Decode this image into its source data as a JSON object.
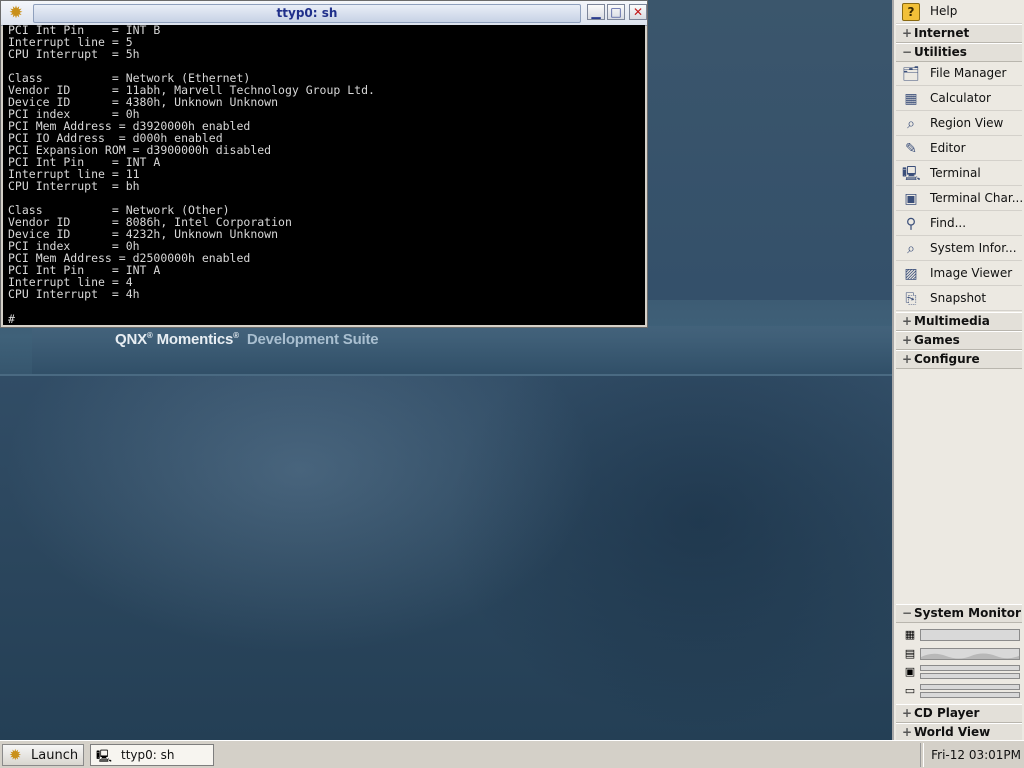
{
  "desktop": {
    "brand": "QNX",
    "brand_reg": "®",
    "brand_product": "Momentics",
    "brand_suffix": "Development Suite"
  },
  "terminal": {
    "title": "ttyp0: sh",
    "lines": [
      "PCI Int Pin    = INT B",
      "Interrupt line = 5",
      "CPU Interrupt  = 5h",
      "",
      "Class          = Network (Ethernet)",
      "Vendor ID      = 11abh, Marvell Technology Group Ltd.",
      "Device ID      = 4380h, Unknown Unknown",
      "PCI index      = 0h",
      "PCI Mem Address = d3920000h enabled",
      "PCI IO Address  = d000h enabled",
      "PCI Expansion ROM = d3900000h disabled",
      "PCI Int Pin    = INT A",
      "Interrupt line = 11",
      "CPU Interrupt  = bh",
      "",
      "Class          = Network (Other)",
      "Vendor ID      = 8086h, Intel Corporation",
      "Device ID      = 4232h, Unknown Unknown",
      "PCI index      = 0h",
      "PCI Mem Address = d2500000h enabled",
      "PCI Int Pin    = INT A",
      "Interrupt line = 4",
      "CPU Interrupt  = 4h"
    ],
    "prompt": "# _"
  },
  "shelf": {
    "help": "Help",
    "groups": {
      "internet": "Internet",
      "utilities": "Utilities",
      "multimedia": "Multimedia",
      "games": "Games",
      "configure": "Configure",
      "system_monitor": "System Monitor",
      "cd_player": "CD Player",
      "world_view": "World View"
    },
    "utilities_items": [
      {
        "label": "File Manager",
        "icon": "file-manager-icon"
      },
      {
        "label": "Calculator",
        "icon": "calculator-icon"
      },
      {
        "label": "Region View",
        "icon": "magnifier-icon"
      },
      {
        "label": "Editor",
        "icon": "editor-icon"
      },
      {
        "label": "Terminal",
        "icon": "terminal-icon"
      },
      {
        "label": "Terminal Char...",
        "icon": "terminal-char-icon"
      },
      {
        "label": "Find...",
        "icon": "find-icon"
      },
      {
        "label": "System Infor...",
        "icon": "system-info-icon"
      },
      {
        "label": "Image Viewer",
        "icon": "image-viewer-icon"
      },
      {
        "label": "Snapshot",
        "icon": "snapshot-icon"
      }
    ]
  },
  "taskbar": {
    "launch": "Launch",
    "task_terminal": "ttyp0: sh",
    "clock": "Fri-12 03:01PM"
  },
  "colors": {
    "title_text": "#1f2f8a",
    "close_red": "#c21818",
    "shelf_bg": "#ece9e2",
    "terminal_bg": "#000000"
  }
}
